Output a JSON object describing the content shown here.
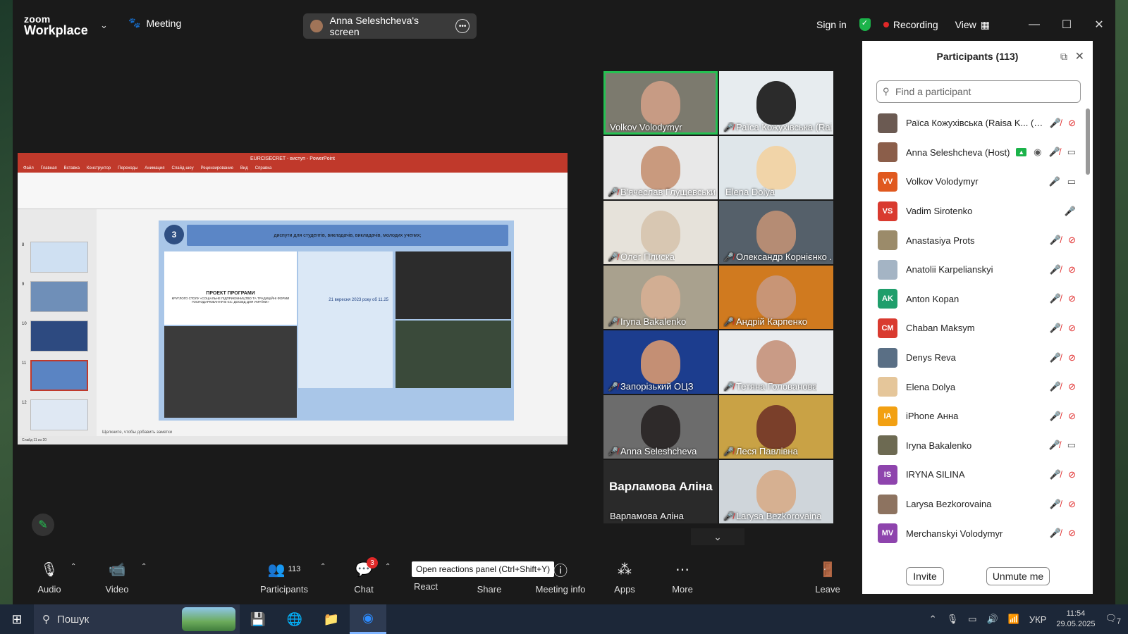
{
  "colors": {
    "accent_green": "#25c152",
    "recording_red": "#e02828",
    "panel_bg": "#ffffff",
    "window_bg": "#1a1a1a"
  },
  "topbar": {
    "logo_line1": "zoom",
    "logo_line2": "Workplace",
    "meeting_label": "Meeting",
    "share_label": "Anna Seleshcheva's screen",
    "sign_in": "Sign in",
    "recording": "Recording",
    "view": "View",
    "icons": [
      "chevron-down-icon",
      "paw-icon",
      "more-icon",
      "shield-icon",
      "minimize-icon",
      "maximize-icon",
      "close-icon"
    ]
  },
  "slide": {
    "number": "3",
    "header_text": "диспути для студентів, викладачів, викладачів, молодих учених;",
    "ppt_title": "EURCISECRET - виступ - PowerPoint",
    "ppt_tabs": [
      "Файл",
      "Главная",
      "Вставка",
      "Конструктор",
      "Переходы",
      "Анимация",
      "Слайд-шоу",
      "Рецензирование",
      "Вид",
      "Справка"
    ],
    "notes_hint": "Щелкните, чтобы добавить заметки",
    "status": "Слайд 11 из 20",
    "thumb_numbers": [
      "8",
      "9",
      "10",
      "11",
      "12"
    ],
    "poster_title": "ПРОЕКТ ПРОГРАМИ",
    "poster_sub": "КРУГЛОГО СТОЛУ «СОЦІАЛЬНЕ ПІДПРИЄМНИЦТВО ТА ТРАДИЦІЙНІ ФОРМИ ГОСПОДАРЮВАННЯ В ЄС: ДОСВІД ДЛЯ УКРАЇНИ»",
    "poster_date": "21 вересня 2023 року об 11.25"
  },
  "gallery": {
    "tiles": [
      {
        "name": "Volkov Volodymyr",
        "muted": false,
        "active": true,
        "bg": "#7c7a6e",
        "face": "#c79b84"
      },
      {
        "name": "Раїса Кожухівська (Rai...",
        "muted": true,
        "active": false,
        "bg": "#e7ecef",
        "face": "#2b2b2b"
      },
      {
        "name": "В'ячеслав Глущевськи...",
        "muted": true,
        "active": false,
        "bg": "#e8e8e8",
        "face": "#c99a7e"
      },
      {
        "name": "Elena Dolya",
        "muted": false,
        "active": false,
        "bg": "#dfe6ea",
        "face": "#f1d4a8"
      },
      {
        "name": "Олег Плиска",
        "muted": true,
        "active": false,
        "bg": "#e6e2da",
        "face": "#d8c7b2"
      },
      {
        "name": "Олександр Корнієнко ...",
        "muted": true,
        "active": false,
        "bg": "#55606a",
        "face": "#b58c74"
      },
      {
        "name": "Iryna Bakalenko",
        "muted": true,
        "active": false,
        "bg": "#a9a18e",
        "face": "#d2ae93"
      },
      {
        "name": "Андрій Карпенко",
        "muted": true,
        "active": false,
        "bg": "#d07a1f",
        "face": "#c89576"
      },
      {
        "name": "Запорізький ОЦЗ",
        "muted": true,
        "active": false,
        "bg": "#1c3d8e",
        "face": "#c48f74"
      },
      {
        "name": "Тетяна Голованова",
        "muted": true,
        "active": false,
        "bg": "#e9ecef",
        "face": "#c99b86"
      },
      {
        "name": "Anna Seleshcheva",
        "muted": true,
        "active": false,
        "bg": "#6c6c6c",
        "face": "#2e2a2a"
      },
      {
        "name": "Леся Павлівна",
        "muted": true,
        "active": false,
        "bg": "#c9a245",
        "face": "#7a3f2a"
      },
      {
        "name": "Варламова Аліна",
        "muted": false,
        "active": false,
        "bg": "#2a2a2a",
        "face": "",
        "big": "Варламова Аліна"
      },
      {
        "name": "Larysa Bezkorovaina",
        "muted": true,
        "active": false,
        "bg": "#cfd5da",
        "face": "#d6b091"
      }
    ]
  },
  "participants": {
    "title": "Participants (113)",
    "search_placeholder": "Find a participant",
    "invite": "Invite",
    "unmute_me": "Unmute me",
    "items": [
      {
        "name": "Раїса Кожухівська (Raisa K... (Me)",
        "initials": "",
        "color": "#6b5a52",
        "mic": "muted",
        "cam": "off"
      },
      {
        "name": "Anna Seleshcheva (Host)",
        "initials": "",
        "color": "#8b5e4a",
        "mic": "muted",
        "cam": "on",
        "sharing": true
      },
      {
        "name": "Volkov Volodymyr",
        "initials": "VV",
        "color": "#e0591f",
        "mic": "on",
        "cam": "on"
      },
      {
        "name": "Vadim Sirotenko",
        "initials": "VS",
        "color": "#d93a2f",
        "mic": "on",
        "cam": "none"
      },
      {
        "name": "Anastasiya Prots",
        "initials": "",
        "color": "#9b8b6a",
        "mic": "muted",
        "cam": "off"
      },
      {
        "name": "Anatolii Karpelianskyi",
        "initials": "",
        "color": "#a4b4c4",
        "mic": "muted",
        "cam": "off"
      },
      {
        "name": "Anton Kopan",
        "initials": "AK",
        "color": "#1f9e6b",
        "mic": "muted",
        "cam": "off"
      },
      {
        "name": "Chaban Maksym",
        "initials": "CM",
        "color": "#d93a2f",
        "mic": "muted",
        "cam": "off"
      },
      {
        "name": "Denys Reva",
        "initials": "",
        "color": "#5a6f85",
        "mic": "muted",
        "cam": "off"
      },
      {
        "name": "Elena Dolya",
        "initials": "",
        "color": "#e5c69a",
        "mic": "muted",
        "cam": "off"
      },
      {
        "name": "iPhone Анна",
        "initials": "IA",
        "color": "#f2a012",
        "mic": "muted",
        "cam": "off"
      },
      {
        "name": "Iryna Bakalenko",
        "initials": "",
        "color": "#6d6a52",
        "mic": "muted",
        "cam": "on"
      },
      {
        "name": "IRYNA SILINA",
        "initials": "IS",
        "color": "#8e44ad",
        "mic": "muted",
        "cam": "off"
      },
      {
        "name": "Larysa Bezkorovaina",
        "initials": "",
        "color": "#8d7360",
        "mic": "muted",
        "cam": "off"
      },
      {
        "name": "Merchanskyi Volodymyr",
        "initials": "MV",
        "color": "#8e44ad",
        "mic": "muted",
        "cam": "off"
      }
    ]
  },
  "toolbar": {
    "audio": "Audio",
    "video": "Video",
    "participants": "Participants",
    "participants_count": "113",
    "chat": "Chat",
    "chat_badge": "3",
    "react": "React",
    "share": "Share",
    "meeting_info": "Meeting info",
    "apps": "Apps",
    "more": "More",
    "leave": "Leave",
    "tooltip": "Open reactions panel (Ctrl+Shift+Y)"
  },
  "taskbar": {
    "search": "Пошук",
    "lang": "УКР",
    "time": "11:54",
    "date": "29.05.2025",
    "notifications": "7"
  }
}
